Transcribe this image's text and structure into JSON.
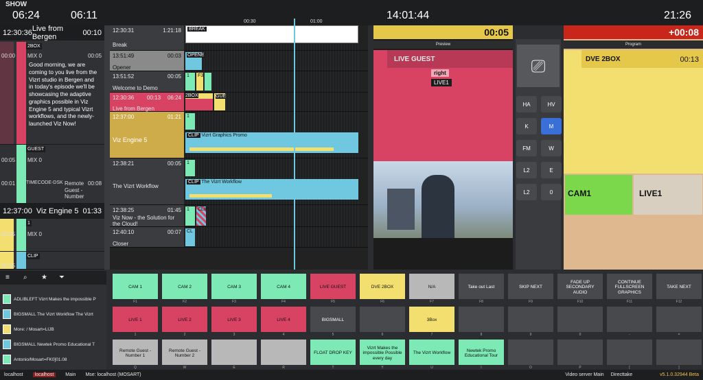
{
  "header": {
    "show": "SHOW",
    "clock1": "06:24",
    "clock2": "06:11",
    "tick1": "00:30",
    "tick2": "01:00",
    "clock_center": "14:01:44",
    "clock_right": "21:26"
  },
  "left": {
    "seg1": {
      "time": "12:30:36",
      "title": "Live from Bergen",
      "dur": "00:10"
    },
    "item1": {
      "tag": "2BOX",
      "mix": "MIX 0",
      "t1": "00:00",
      "t2": "00:05",
      "text": "Good morning, we are coming to you live from the Vizrt studio in Bergen and in today's episode we'll be showcasing the adaptive graphics possible in Viz Engine 5 and typical Vizrt workflows, and the newly-launched Viz Now!"
    },
    "item2": {
      "tag": "GUEST",
      "mix": "MIX 0",
      "t1": "00:05",
      "t2": "00:01",
      "cmd": "TIMECODE-DSK",
      "name": "Remote Guest - Number",
      "dur": "00:08"
    },
    "seg2": {
      "time": "12:37:00",
      "title": "Viz Engine 5",
      "dur": "01:33"
    },
    "item3": {
      "tag": "1",
      "mix": "MIX 0",
      "t1": "00:05"
    },
    "item4": {
      "tag": "CLIP",
      "t1": "00:05"
    }
  },
  "rundown": [
    {
      "time": "12:30:31",
      "dur": "1:21:18",
      "title": "Break",
      "clip": "BREAK"
    },
    {
      "time": "13:51:49",
      "dur": "00:03",
      "title": "Opener",
      "clip": "OPENE"
    },
    {
      "time": "13:51:52",
      "dur": "00:05",
      "title": "Welcome to Demo",
      "clip": "1",
      "clip2": "F3"
    },
    {
      "time": "12:30:36",
      "dur": "06:24",
      "title": "Live from Bergen",
      "prev": "00:13",
      "clip": "2BOX",
      "clip2": "GUE"
    },
    {
      "time": "12:37:00",
      "dur": "01:21",
      "title": "Viz Engine 5",
      "clip": "1",
      "clip2": "CLIP",
      "clip2text": "Vizrt Graphics Promo"
    },
    {
      "time": "12:38:21",
      "dur": "00:05",
      "title": "The Vizrt Workflow",
      "clip": "1",
      "clip2": "CLIP",
      "clip2text": "The Vizrt Workflow"
    },
    {
      "time": "12:38:25",
      "dur": "01:45",
      "title": "Viz Now - the Solution for the Cloud!",
      "clip": "1",
      "clip2": "CLIP"
    },
    {
      "time": "12:40:10",
      "dur": "00:07",
      "title": "Closer",
      "clip": "CL"
    }
  ],
  "preview": {
    "timer": "00:05",
    "label": "Preview",
    "item": "LIVE GUEST",
    "tag1": "right",
    "tag2": "LIVE1"
  },
  "program": {
    "timer": "+00:08",
    "label": "Program",
    "item": "DVE 2BOX",
    "dur": "00:13",
    "cam": "CAM1",
    "live": "LIVE1"
  },
  "grid_buttons": [
    "HA",
    "HV",
    "K",
    "M",
    "FM",
    "W",
    "L2",
    "E",
    "L2",
    "0"
  ],
  "filters": [
    "ADLIBLEFT Vizrt Makes the impossible P",
    "BIGSMALL The Vizrt Workflow The Vizrt",
    "More: / Mosart=LIJB",
    "BIGSMALL Newtek Promo Educational T",
    "Antonio/Mosart=FK0]01.08"
  ],
  "keys": [
    [
      {
        "l": "CAM 1",
        "k": "F1",
        "c": "#7de9b5"
      },
      {
        "l": "CAM 2",
        "k": "F2",
        "c": "#7de9b5"
      },
      {
        "l": "CAM 3",
        "k": "F3",
        "c": "#7de9b5"
      },
      {
        "l": "CAM 4",
        "k": "F4",
        "c": "#7de9b5"
      },
      {
        "l": "LIVE GUEST",
        "k": "F5",
        "c": "#d84363"
      },
      {
        "l": "DVE 2BOX",
        "k": "F6",
        "c": "#f3df6f"
      },
      {
        "l": "N/A",
        "k": "F7",
        "c": "#b8b8b8"
      },
      {
        "l": "Take out Last",
        "k": "F8",
        "c": "#48494c"
      },
      {
        "l": "SKIP NEXT",
        "k": "F9",
        "c": "#48494c"
      },
      {
        "l": "FADE UP SECONDARY AUDIO",
        "k": "F10",
        "c": "#48494c"
      },
      {
        "l": "CONTINUE FULLSCREEN GRAPHICS",
        "k": "F11",
        "c": "#48494c"
      },
      {
        "l": "TAKE NEXT",
        "k": "F12",
        "c": "#48494c"
      }
    ],
    [
      {
        "l": "LIVE 1",
        "k": "1",
        "c": "#d84363"
      },
      {
        "l": "LIVE 2",
        "k": "2",
        "c": "#d84363"
      },
      {
        "l": "LIVE 3",
        "k": "3",
        "c": "#d84363"
      },
      {
        "l": "LIVE 4",
        "k": "4",
        "c": "#d84363"
      },
      {
        "l": "BIGSMALL",
        "k": "5",
        "c": "#48494c"
      },
      {
        "l": "",
        "k": "6",
        "c": "#48494c"
      },
      {
        "l": "3Box",
        "k": "7",
        "c": "#f3df6f"
      },
      {
        "l": "",
        "k": "8",
        "c": "#48494c"
      },
      {
        "l": "",
        "k": "9",
        "c": "#48494c"
      },
      {
        "l": "",
        "k": "0",
        "c": "#48494c"
      },
      {
        "l": "",
        "k": "-",
        "c": "#48494c"
      },
      {
        "l": "",
        "k": "=",
        "c": "#48494c"
      }
    ],
    [
      {
        "l": "Remote Guest - Number 1",
        "k": "Q",
        "c": "#b8b8b8"
      },
      {
        "l": "Remote Guest - Number 2",
        "k": "W",
        "c": "#b8b8b8"
      },
      {
        "l": "",
        "k": "E",
        "c": "#b8b8b8"
      },
      {
        "l": "",
        "k": "R",
        "c": "#b8b8b8"
      },
      {
        "l": "FLOAT DROP KEY",
        "k": "T",
        "c": "#7de9b5"
      },
      {
        "l": "Vizrt Makes the impossible Possible every day",
        "k": "Y",
        "c": "#7de9b5"
      },
      {
        "l": "The Vizrt Workflow",
        "k": "U",
        "c": "#7de9b5"
      },
      {
        "l": "Newtek Promo Educational Tour",
        "k": "I",
        "c": "#7de9b5"
      },
      {
        "l": "",
        "k": "O",
        "c": "#48494c"
      },
      {
        "l": "",
        "k": "P",
        "c": "#48494c"
      },
      {
        "l": "",
        "k": "[",
        "c": "#48494c"
      },
      {
        "l": "",
        "k": "]",
        "c": "#48494c"
      }
    ]
  ],
  "status": {
    "s1": "localhost",
    "s2": "localhost",
    "s3": "Main",
    "s4": "Mse: localhost (MOSART)",
    "s5": "Video server Main",
    "s6": "Directtake",
    "s7": "v5.1.0.32944 Beta"
  }
}
